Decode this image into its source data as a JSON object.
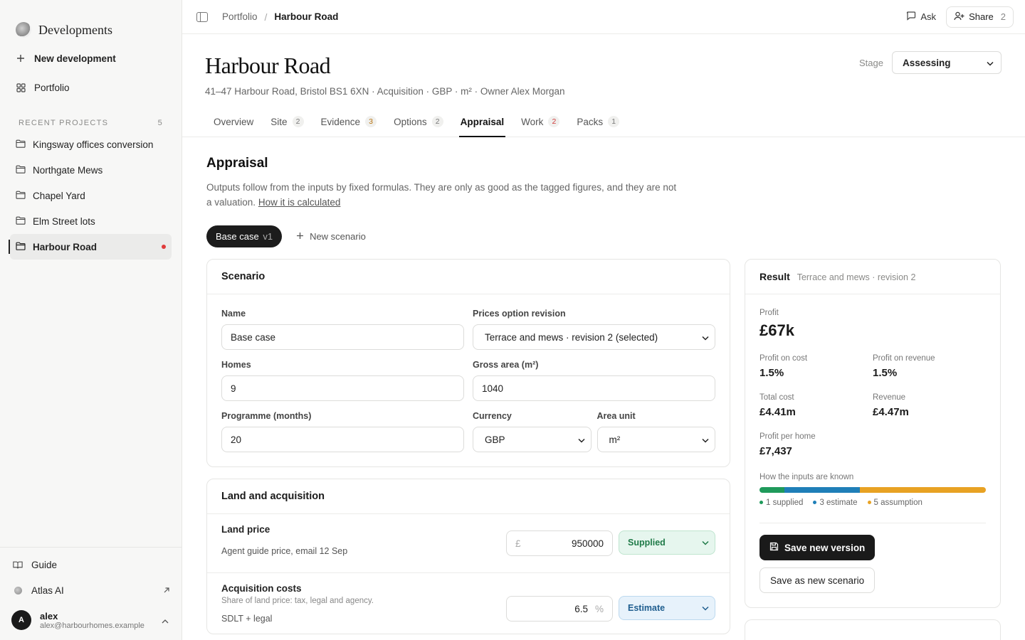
{
  "sidebar": {
    "brand": "Developments",
    "new_label": "New development",
    "portfolio_label": "Portfolio",
    "recent_label": "RECENT PROJECTS",
    "recent_count": "5",
    "projects": [
      {
        "label": "Kingsway offices conversion"
      },
      {
        "label": "Northgate Mews"
      },
      {
        "label": "Chapel Yard"
      },
      {
        "label": "Elm Street lots"
      },
      {
        "label": "Harbour Road"
      }
    ],
    "guide_label": "Guide",
    "atlas_label": "Atlas AI",
    "user": {
      "initial": "A",
      "name": "alex",
      "email": "alex@harbourhomes.example"
    }
  },
  "topbar": {
    "crumb_root": "Portfolio",
    "crumb_sep": "/",
    "crumb_current": "Harbour Road",
    "ask_label": "Ask",
    "share_label": "Share",
    "share_count": "2"
  },
  "header": {
    "title": "Harbour Road",
    "subtitle": "41–47 Harbour Road, Bristol BS1 6XN · Acquisition · GBP · m² · Owner Alex Morgan",
    "stage_label": "Stage",
    "stage_value": "Assessing",
    "tabs": [
      {
        "label": "Overview",
        "badge": ""
      },
      {
        "label": "Site",
        "badge": "2"
      },
      {
        "label": "Evidence",
        "badge": "3"
      },
      {
        "label": "Options",
        "badge": "2"
      },
      {
        "label": "Appraisal",
        "badge": ""
      },
      {
        "label": "Work",
        "badge": "2"
      },
      {
        "label": "Packs",
        "badge": "1"
      }
    ]
  },
  "appraisal": {
    "heading": "Appraisal",
    "desc": "Outputs follow from the inputs by fixed formulas. They are only as good as the tagged figures, and they are not a valuation.",
    "desc_link": "How it is calculated",
    "scenario_pill": "Base case",
    "scenario_version": "v1",
    "new_scenario": "New scenario"
  },
  "scenario": {
    "title": "Scenario",
    "name_label": "Name",
    "name_value": "Base case",
    "prices_label": "Prices option revision",
    "prices_value": "Terrace and mews · revision 2 (selected)",
    "homes_label": "Homes",
    "homes_value": "9",
    "gross_label": "Gross area (m²)",
    "gross_value": "1040",
    "programme_label": "Programme (months)",
    "programme_value": "20",
    "currency_label": "Currency",
    "currency_value": "GBP",
    "unit_label": "Area unit",
    "unit_value": "m²"
  },
  "land": {
    "title": "Land and acquisition",
    "price_label": "Land price",
    "price_note": "Agent guide price, email 12 Sep",
    "price_currency": "£",
    "price_value": "950000",
    "price_tag": "Supplied",
    "acq_label": "Acquisition costs",
    "acq_sub": "Share of land price: tax, legal and agency.",
    "acq_note": "SDLT + legal",
    "acq_value": "6.5",
    "acq_unit": "%",
    "acq_tag": "Estimate"
  },
  "result": {
    "title": "Result",
    "subtitle": "Terrace and mews · revision 2",
    "profit_label": "Profit",
    "profit_value": "£67k",
    "poc_label": "Profit on cost",
    "poc_value": "1.5%",
    "por_label": "Profit on revenue",
    "por_value": "1.5%",
    "cost_label": "Total cost",
    "cost_value": "£4.41m",
    "rev_label": "Revenue",
    "rev_value": "£4.47m",
    "pph_label": "Profit per home",
    "pph_value": "£7,437",
    "known_label": "How the inputs are known",
    "known": [
      {
        "label": "1 supplied",
        "count": 1,
        "color": "#1f9a5b"
      },
      {
        "label": "3 estimate",
        "count": 3,
        "color": "#1f7fb8"
      },
      {
        "label": "5 assumption",
        "count": 5,
        "color": "#e8a223"
      }
    ],
    "save_version": "Save new version",
    "save_scenario": "Save as new scenario"
  }
}
